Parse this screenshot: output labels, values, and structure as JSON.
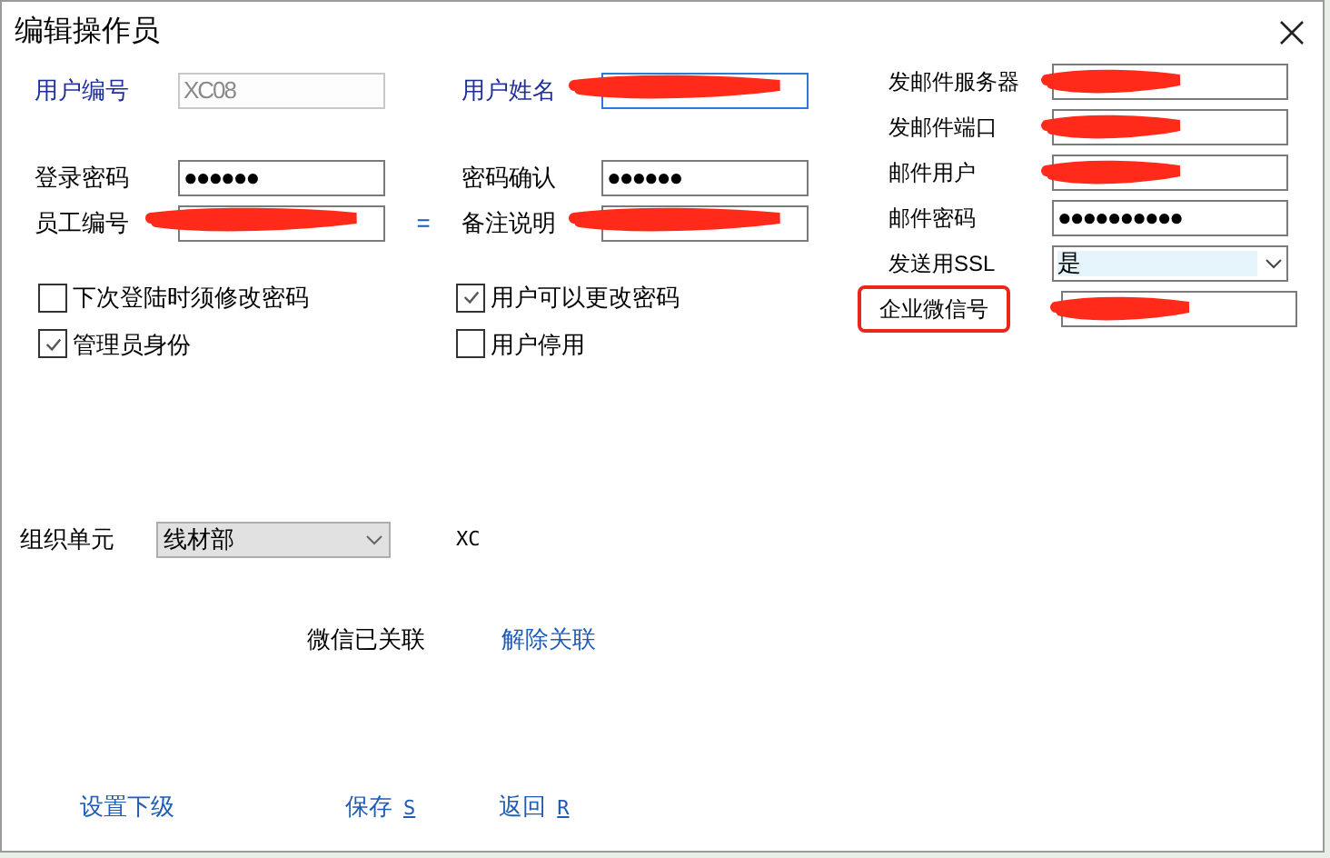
{
  "window": {
    "title": "编辑操作员"
  },
  "left_rows": [
    {
      "fields": [
        {
          "label": "用户编号",
          "value": "XC08",
          "disabled": true,
          "focused": false,
          "redacted": false
        },
        {
          "label": "用户姓名",
          "disabled": false,
          "focused": true,
          "redacted": true
        }
      ]
    },
    {
      "fields": [
        {
          "label": "登录密码",
          "value": "●●●●●●",
          "disabled": false,
          "focused": false,
          "redacted": false
        },
        {
          "label": "密码确认",
          "value": "●●●●●●",
          "disabled": false,
          "focused": false,
          "redacted": false
        }
      ]
    },
    {
      "separator": "=",
      "fields": [
        {
          "label": "员工编号",
          "disabled": false,
          "focused": false,
          "redacted": true
        },
        {
          "label": "备注说明",
          "disabled": false,
          "focused": false,
          "redacted": true
        }
      ]
    }
  ],
  "checkboxes": [
    {
      "label": "下次登陆时须修改密码",
      "checked": false
    },
    {
      "label": "用户可以更改密码",
      "checked": true
    },
    {
      "label": "管理员身份",
      "checked": true
    },
    {
      "label": "用户停用",
      "checked": false
    }
  ],
  "right_fields": [
    {
      "kind": "text",
      "label": "发邮件服务器",
      "redacted": true,
      "highlighted": false
    },
    {
      "kind": "text",
      "label": "发邮件端口",
      "redacted": true,
      "highlighted": false
    },
    {
      "kind": "text",
      "label": "邮件用户",
      "redacted": true,
      "highlighted": false
    },
    {
      "kind": "text",
      "label": "邮件密码",
      "value": "●●●●●●●●●●",
      "redacted": false,
      "highlighted": false
    },
    {
      "kind": "select",
      "label": "发送用SSL",
      "value": "是",
      "redacted": false,
      "highlighted": false
    },
    {
      "kind": "text",
      "label": "企业微信号",
      "redacted": true,
      "highlighted": true
    }
  ],
  "org_unit": {
    "label": "组织单元",
    "value": "线材部",
    "code": "XC"
  },
  "wechat": {
    "status": "微信已关联",
    "action": "解除关联"
  },
  "buttons": [
    {
      "label": "设置下级"
    },
    {
      "label": "保存",
      "hotkey": "S"
    },
    {
      "label": "返回",
      "hotkey": "R"
    }
  ]
}
